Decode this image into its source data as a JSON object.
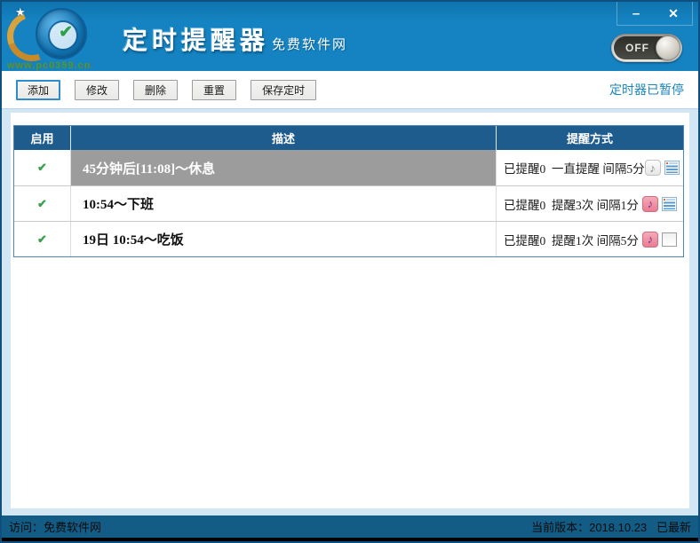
{
  "titlebar": {
    "title": "定时提醒器",
    "subtitle": "免费软件网",
    "logo_watermark": "www.pc0359.cn",
    "toggle_state": "OFF"
  },
  "toolbar": {
    "buttons": [
      "添加",
      "修改",
      "删除",
      "重置",
      "保存定时"
    ],
    "status_text": "定时器已暂停"
  },
  "table": {
    "headers": [
      "启用",
      "描述",
      "提醒方式"
    ],
    "rows": [
      {
        "enabled": true,
        "selected": true,
        "description": "45分钟后[11:08]～休息",
        "reminder": "已提醒0  一直提醒 间隔5分",
        "icons": [
          "music-note-icon-muted",
          "notes-icon"
        ]
      },
      {
        "enabled": true,
        "selected": false,
        "description": "10:54～下班",
        "reminder": "已提醒0  提醒3次 间隔1分",
        "icons": [
          "music-note-icon",
          "notes-icon"
        ]
      },
      {
        "enabled": true,
        "selected": false,
        "description": "19日 10:54～吃饭",
        "reminder": "已提醒0  提醒1次 间隔5分",
        "icons": [
          "music-note-icon",
          "checkbox-icon"
        ]
      }
    ]
  },
  "statusbar": {
    "left": "访问：免费软件网",
    "right": "当前版本：2018.10.23   已最新"
  },
  "icons": {
    "music_note_glyph": "♪",
    "enabled_check_glyph": "✔",
    "minimize_glyph": "–",
    "close_glyph": "✕",
    "logo_star_glyph": "★",
    "logo_check_glyph": "✔"
  },
  "colors": {
    "titlebar_blue": "#1583c1",
    "window_border": "#0e4f7e",
    "table_header_blue": "#1f5c8e",
    "statusbar_blue": "#135c86",
    "link_blue": "#1b86b6",
    "selected_row_gray": "#9c9c9c",
    "check_green": "#3ba050",
    "note_icon_pink": "#e87d92",
    "note_glyph_purple": "#7b2d8e",
    "watermark_green": "#2fa546"
  }
}
